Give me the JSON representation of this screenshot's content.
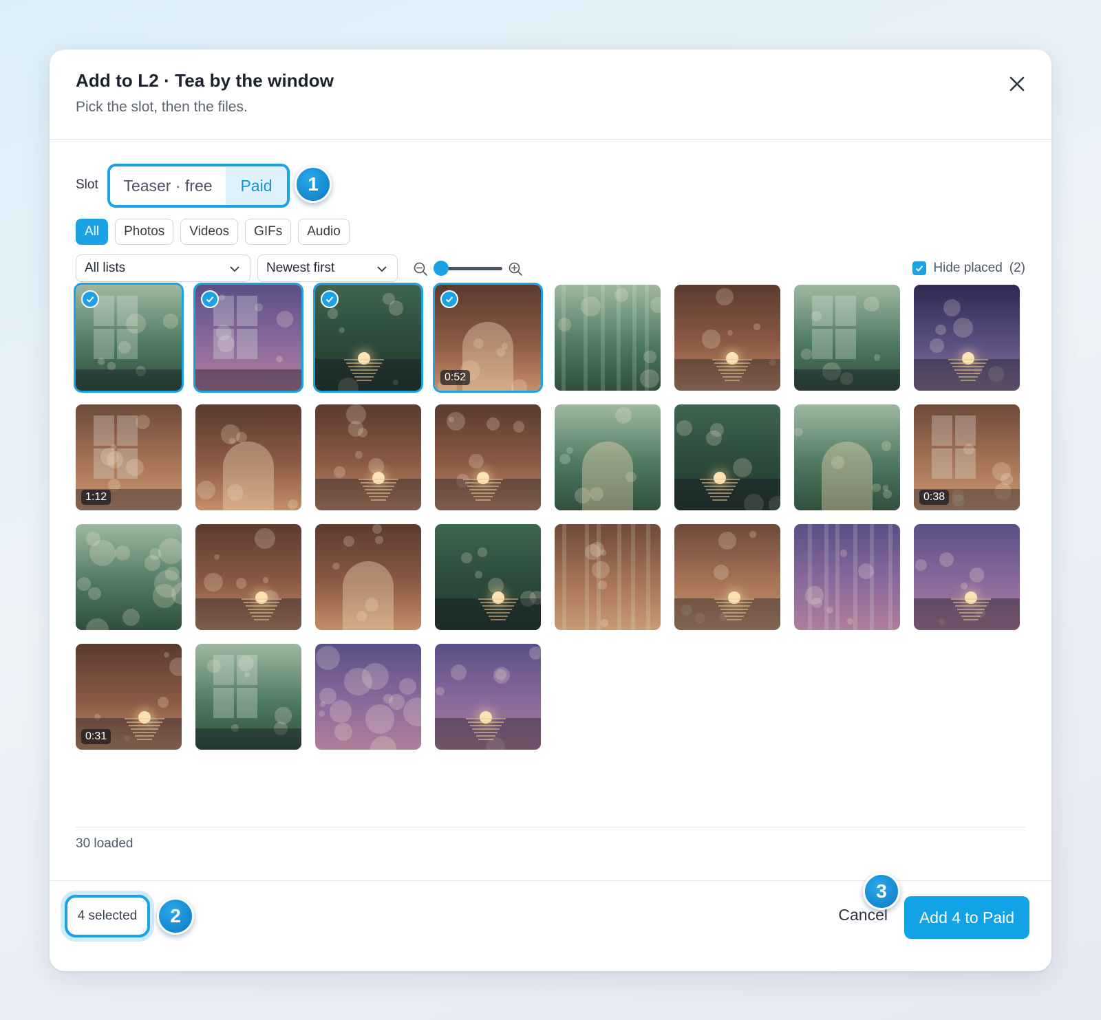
{
  "dialog": {
    "title": "Add to L2 · Tea by the window",
    "subtitle": "Pick the slot, then the files."
  },
  "slot": {
    "label": "Slot",
    "options": [
      "Teaser · free",
      "Paid"
    ],
    "selected": "Paid"
  },
  "badges": {
    "one": "1",
    "two": "2",
    "three": "3"
  },
  "filters": [
    {
      "label": "All",
      "active": true
    },
    {
      "label": "Photos",
      "active": false
    },
    {
      "label": "Videos",
      "active": false
    },
    {
      "label": "GIFs",
      "active": false
    },
    {
      "label": "Audio",
      "active": false
    }
  ],
  "toolbar": {
    "list_select": "All lists",
    "sort_select": "Newest first",
    "zoom_level": 0,
    "hide_placed_label": "Hide placed",
    "hide_placed_count": "(2)",
    "hide_placed_checked": true
  },
  "media": [
    {
      "type": "window",
      "palette": "green",
      "selected": true,
      "duration": ""
    },
    {
      "type": "window",
      "palette": "purple",
      "selected": true,
      "duration": ""
    },
    {
      "type": "sunset",
      "palette": "darkgreen",
      "selected": true,
      "duration": ""
    },
    {
      "type": "arch",
      "palette": "brown",
      "selected": true,
      "duration": "0:52"
    },
    {
      "type": "streaks",
      "palette": "green",
      "selected": false,
      "duration": ""
    },
    {
      "type": "sunset",
      "palette": "brown",
      "selected": false,
      "duration": ""
    },
    {
      "type": "window",
      "palette": "green",
      "selected": false,
      "duration": ""
    },
    {
      "type": "sunset",
      "palette": "night",
      "selected": false,
      "duration": ""
    },
    {
      "type": "window",
      "palette": "tan",
      "selected": false,
      "duration": "1:12"
    },
    {
      "type": "arch",
      "palette": "brown",
      "selected": false,
      "duration": ""
    },
    {
      "type": "sunset",
      "palette": "brown",
      "selected": false,
      "duration": ""
    },
    {
      "type": "sunset",
      "palette": "brown",
      "selected": false,
      "duration": ""
    },
    {
      "type": "arch",
      "palette": "green",
      "selected": false,
      "duration": ""
    },
    {
      "type": "sunset",
      "palette": "darkgreen",
      "selected": false,
      "duration": ""
    },
    {
      "type": "arch",
      "palette": "green",
      "selected": false,
      "duration": ""
    },
    {
      "type": "window",
      "palette": "tan",
      "selected": false,
      "duration": "0:38"
    },
    {
      "type": "bokeh",
      "palette": "green",
      "selected": false,
      "duration": ""
    },
    {
      "type": "sunset",
      "palette": "brown",
      "selected": false,
      "duration": ""
    },
    {
      "type": "arch",
      "palette": "brown",
      "selected": false,
      "duration": ""
    },
    {
      "type": "sunset",
      "palette": "darkgreen",
      "selected": false,
      "duration": ""
    },
    {
      "type": "streaks",
      "palette": "tan",
      "selected": false,
      "duration": ""
    },
    {
      "type": "sunset",
      "palette": "tan",
      "selected": false,
      "duration": ""
    },
    {
      "type": "streaks",
      "palette": "purple",
      "selected": false,
      "duration": ""
    },
    {
      "type": "sunset",
      "palette": "purple",
      "selected": false,
      "duration": ""
    },
    {
      "type": "sunset",
      "palette": "brown",
      "selected": false,
      "duration": "0:31"
    },
    {
      "type": "window",
      "palette": "green",
      "selected": false,
      "duration": ""
    },
    {
      "type": "bokeh",
      "palette": "purple",
      "selected": false,
      "duration": ""
    },
    {
      "type": "sunset",
      "palette": "purple",
      "selected": false,
      "duration": ""
    }
  ],
  "palettes": {
    "green": [
      "#9fb8a0",
      "#4f7a62",
      "#2f4f3c"
    ],
    "darkgreen": [
      "#3f6650",
      "#2c4a3a",
      "#223a2e"
    ],
    "purple": [
      "#5a4f86",
      "#8a6a9c",
      "#b07e9a"
    ],
    "brown": [
      "#5a3b30",
      "#8c5a44",
      "#c48e68"
    ],
    "tan": [
      "#6e4a3a",
      "#a77456",
      "#c99a74"
    ],
    "night": [
      "#2d2a52",
      "#5a4f80",
      "#8e7598"
    ]
  },
  "status": {
    "loaded": "30 loaded"
  },
  "footer": {
    "selected_count": "4 selected",
    "cancel_label": "Cancel",
    "primary_label": "Add 4 to Paid"
  },
  "colors": {
    "accent": "#1aa2e4"
  }
}
